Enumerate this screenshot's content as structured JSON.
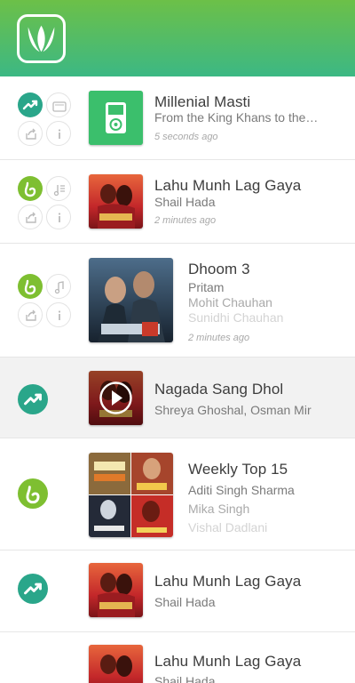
{
  "app": {
    "name": "JioSaavn",
    "brand_color": "#2bc5b4",
    "icon": "saavn-logo-icon"
  },
  "feed": [
    {
      "type": "playlist",
      "title": "Millenial Masti",
      "subtitle": "From the King Khans to the…",
      "time": "5 seconds ago",
      "badge_icon": "trending-icon",
      "media_icon": "radio-icon",
      "actions": [
        "share-icon",
        "info-icon"
      ],
      "art": "ipod-icon"
    },
    {
      "type": "album",
      "title": "Lahu Munh Lag Gaya",
      "subtitle": "Shail Hada",
      "time": "2 minutes ago",
      "badge_icon": "jio-icon",
      "media_icon": "queue-icon",
      "actions": [
        "share-icon",
        "info-icon"
      ]
    },
    {
      "type": "album",
      "title": "Dhoom 3",
      "artists": [
        "Pritam",
        "Mohit Chauhan",
        "Sunidhi Chauhan"
      ],
      "time": "2 minutes ago",
      "badge_icon": "jio-icon",
      "media_icon": "music-note-icon",
      "actions": [
        "share-icon",
        "info-icon"
      ]
    },
    {
      "type": "playing",
      "title": "Nagada Sang Dhol",
      "subtitle": "Shreya Ghoshal, Osman Mir",
      "badge_icon": "trending-icon",
      "play_icon": "play-icon"
    },
    {
      "type": "playlist",
      "title": "Weekly Top 15",
      "artists": [
        "Aditi Singh Sharma",
        "Mika Singh",
        "Vishal Dadlani"
      ],
      "badge_icon": "jio-icon"
    },
    {
      "type": "album",
      "title": "Lahu Munh Lag Gaya",
      "subtitle": "Shail Hada",
      "badge_icon": "trending-icon"
    },
    {
      "type": "album",
      "title": "Lahu Munh Lag Gaya",
      "subtitle": "Shail Hada"
    }
  ]
}
